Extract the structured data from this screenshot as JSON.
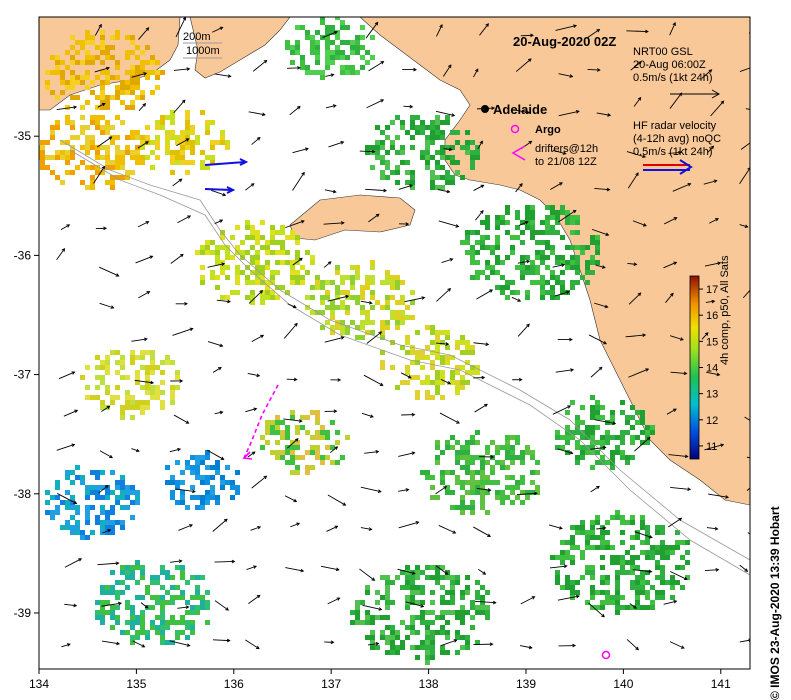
{
  "title": "20-Aug-2020 02Z",
  "credit": "© IMOS 23-Aug-2020 13:39 Hobart",
  "isobath_legend": [
    "200m",
    "1000m"
  ],
  "city": "Adelaide",
  "argo_label": "Argo",
  "drifters_label": [
    "drifters@12h",
    "to 21/08 12Z"
  ],
  "gsl_legend": [
    "NRT00 GSL",
    "20-Aug 06:00Z",
    "0.5m/s (1kt 24h)"
  ],
  "hf_legend": [
    "HF radar velocity",
    "(4-12h avg) noQC",
    "0.5m/s (1kt 24h)"
  ],
  "colorbar": {
    "label": "4h comp, p50, All Sats",
    "ticks": [
      "11",
      "12",
      "13",
      "14",
      "15",
      "16",
      "17"
    ],
    "range": [
      10.5,
      17.5
    ]
  },
  "axes": {
    "x_ticks": [
      "134",
      "135",
      "136",
      "137",
      "138",
      "139",
      "140",
      "141"
    ],
    "y_ticks": [
      "-35",
      "-36",
      "-37",
      "-38",
      "-39"
    ],
    "x_range": [
      134,
      141.3
    ],
    "y_range": [
      -39.47,
      -34.0
    ]
  },
  "colors": {
    "land": "#f9c899",
    "isobath": "#9a9a9a",
    "drifter": "#ff00ff",
    "hf_red": "#e00000",
    "hf_blue": "#1010e0"
  }
}
